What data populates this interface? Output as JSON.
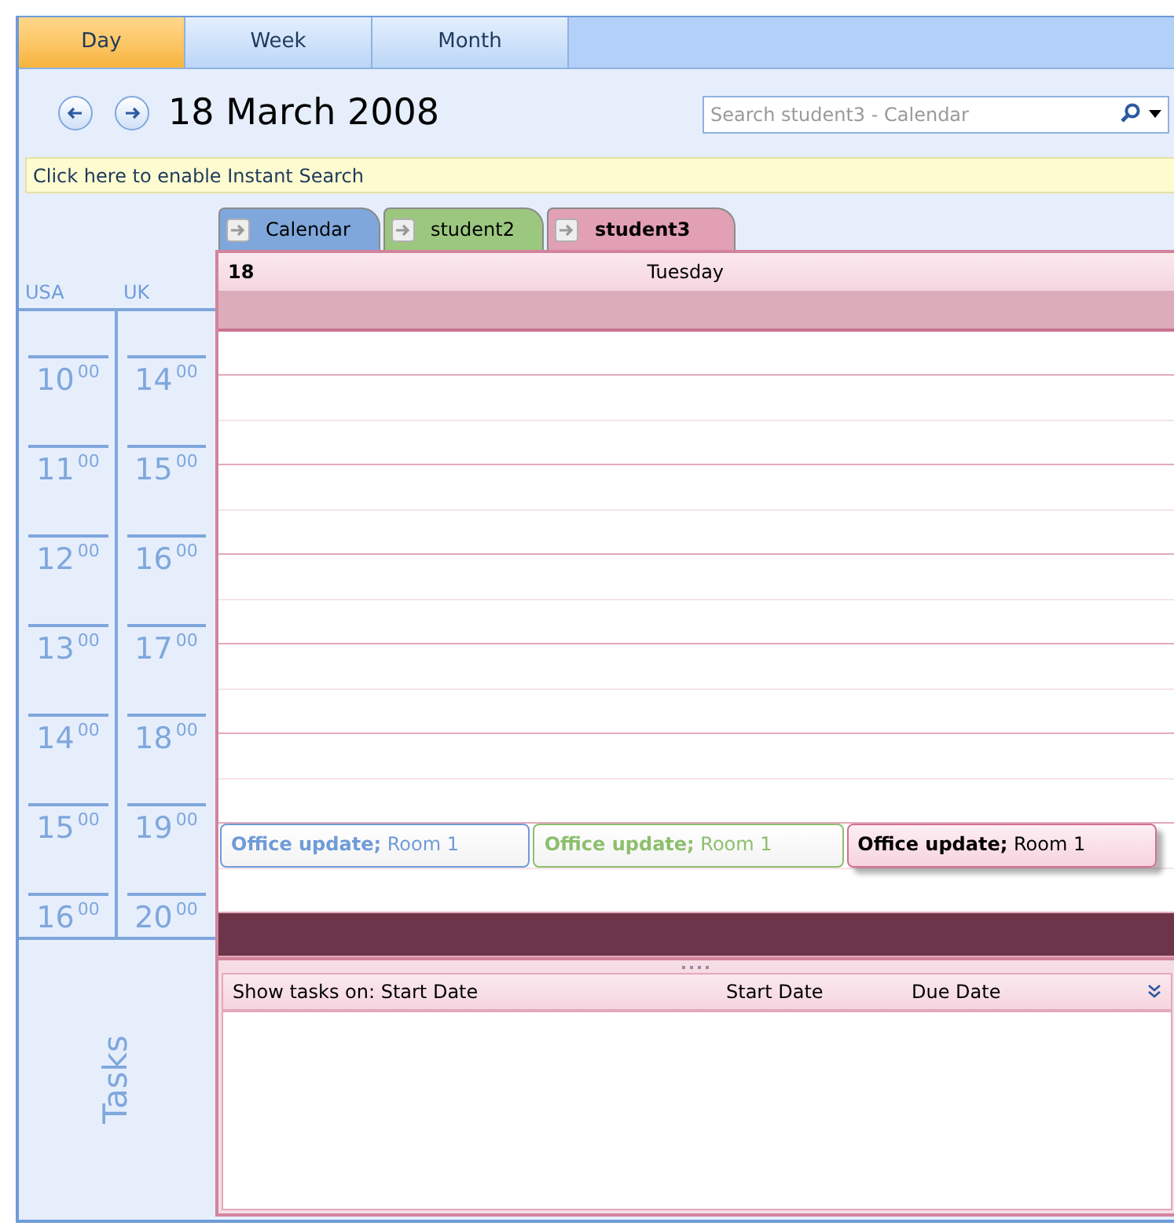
{
  "view_tabs": [
    {
      "label": "Day",
      "selected": true
    },
    {
      "label": "Week",
      "selected": false
    },
    {
      "label": "Month",
      "selected": false
    }
  ],
  "date_title": "18 March 2008",
  "search": {
    "placeholder": "Search student3 - Calendar"
  },
  "instant_search_bar": "Click here to enable Instant Search",
  "calendar_tabs": [
    {
      "label": "Calendar",
      "color": "#7fa7dc",
      "selected": false
    },
    {
      "label": "student2",
      "color": "#9cc77f",
      "selected": false
    },
    {
      "label": "student3",
      "color": "#e2a0b4",
      "selected": true
    }
  ],
  "day_header": {
    "day": "18",
    "weekday": "Tuesday"
  },
  "time_zones": [
    "USA",
    "UK"
  ],
  "slots": [
    {
      "kind": "half",
      "selected": false
    },
    {
      "kind": "hour",
      "usa": {
        "hour": "10",
        "minutes": "00"
      },
      "uk": {
        "hour": "14",
        "minutes": "00"
      },
      "selected": false
    },
    {
      "kind": "hour",
      "usa": {
        "hour": "11",
        "minutes": "00"
      },
      "uk": {
        "hour": "15",
        "minutes": "00"
      },
      "selected": false
    },
    {
      "kind": "hour",
      "usa": {
        "hour": "12",
        "minutes": "00"
      },
      "uk": {
        "hour": "16",
        "minutes": "00"
      },
      "selected": false
    },
    {
      "kind": "hour",
      "usa": {
        "hour": "13",
        "minutes": "00"
      },
      "uk": {
        "hour": "17",
        "minutes": "00"
      },
      "selected": false
    },
    {
      "kind": "hour",
      "usa": {
        "hour": "14",
        "minutes": "00"
      },
      "uk": {
        "hour": "18",
        "minutes": "00"
      },
      "selected": false
    },
    {
      "kind": "hour",
      "usa": {
        "hour": "15",
        "minutes": "00"
      },
      "uk": {
        "hour": "19",
        "minutes": "00"
      },
      "selected": false,
      "events": [
        {
          "text": "**Office update;** Room 1",
          "color": "#6f9bd8",
          "selected": false
        },
        {
          "text": "**Office update;** Room 1",
          "color": "#8cbf6c",
          "selected": false
        },
        {
          "text": "**Office update;** Room 1",
          "color": "#d2708f",
          "selected": true
        }
      ]
    },
    {
      "kind": "half",
      "usa": {
        "hour": "16",
        "minutes": "00"
      },
      "uk": {
        "hour": "20",
        "minutes": "00"
      },
      "selected": true
    }
  ],
  "tasks": {
    "label": "Tasks",
    "columns": [
      "Show tasks on: Start Date",
      "Start Date",
      "Due Date"
    ]
  }
}
